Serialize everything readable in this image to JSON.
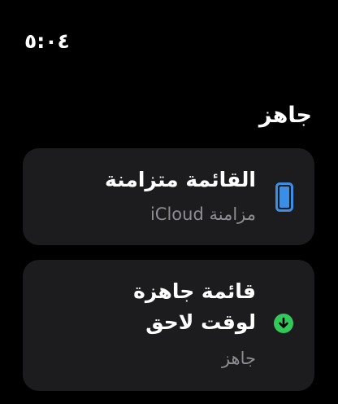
{
  "status": {
    "time": "٥:٠٤"
  },
  "section": {
    "title": "جاهز"
  },
  "cards": [
    {
      "title": "القائمة متزامنة",
      "subtitle": "مزامنة iCloud",
      "icon": "iphone-icon",
      "icon_color": "#3a8ee6"
    },
    {
      "title_line1": "قائمة جاهزة",
      "title_line2": "لوقت لاحق",
      "subtitle": "جاهز",
      "icon": "download-circle-icon",
      "icon_color": "#32c85a"
    }
  ]
}
